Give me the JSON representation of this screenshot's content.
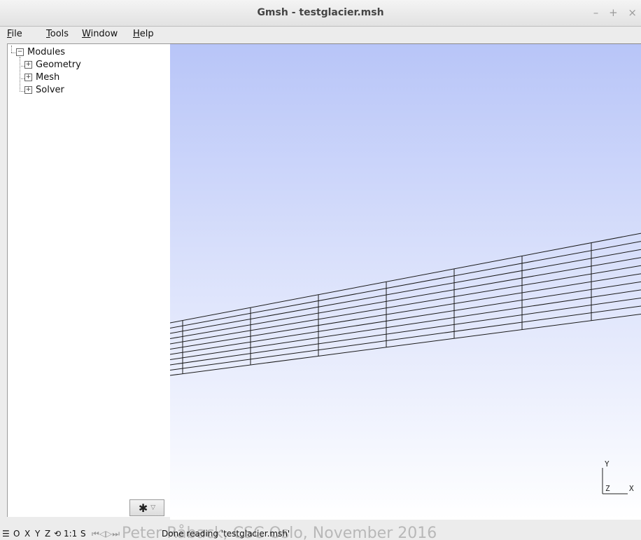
{
  "window": {
    "title": "Gmsh - testglacier.msh",
    "buttons": {
      "minimize": "–",
      "maximize": "+",
      "close": "×"
    }
  },
  "menubar": {
    "items": [
      {
        "accel": "F",
        "rest": "ile"
      },
      {
        "accel": "T",
        "rest": "ools"
      },
      {
        "accel": "W",
        "rest": "indow"
      },
      {
        "accel": "H",
        "rest": "elp"
      }
    ]
  },
  "tree": {
    "root": {
      "label": "Modules",
      "expander": "−"
    },
    "children": [
      {
        "label": "Geometry",
        "expander": "+"
      },
      {
        "label": "Mesh",
        "expander": "+"
      },
      {
        "label": "Solver",
        "expander": "+"
      }
    ]
  },
  "options_button": {
    "gear_icon": "✱",
    "dropdown_icon": "▽"
  },
  "axes": {
    "y": "Y",
    "z": "Z",
    "x": "X"
  },
  "statusbar": {
    "menu_icon": "☰",
    "o": "O",
    "x": "X",
    "y": "Y",
    "z": "Z",
    "rotate_icon": "⟲",
    "scale": "1:1",
    "s": "S",
    "play_controls": "⏮◁▷⏭",
    "message": "Done reading 'testglacier.msh'",
    "watermark": "Peter Råback, CSC Oslo, November 2016"
  },
  "colors": {
    "viewport_top": "#b8c5f8",
    "viewport_bottom": "#ffffff",
    "mesh_line": "#1a1a1a"
  },
  "mesh": {
    "layers": 10,
    "columns": 7
  }
}
